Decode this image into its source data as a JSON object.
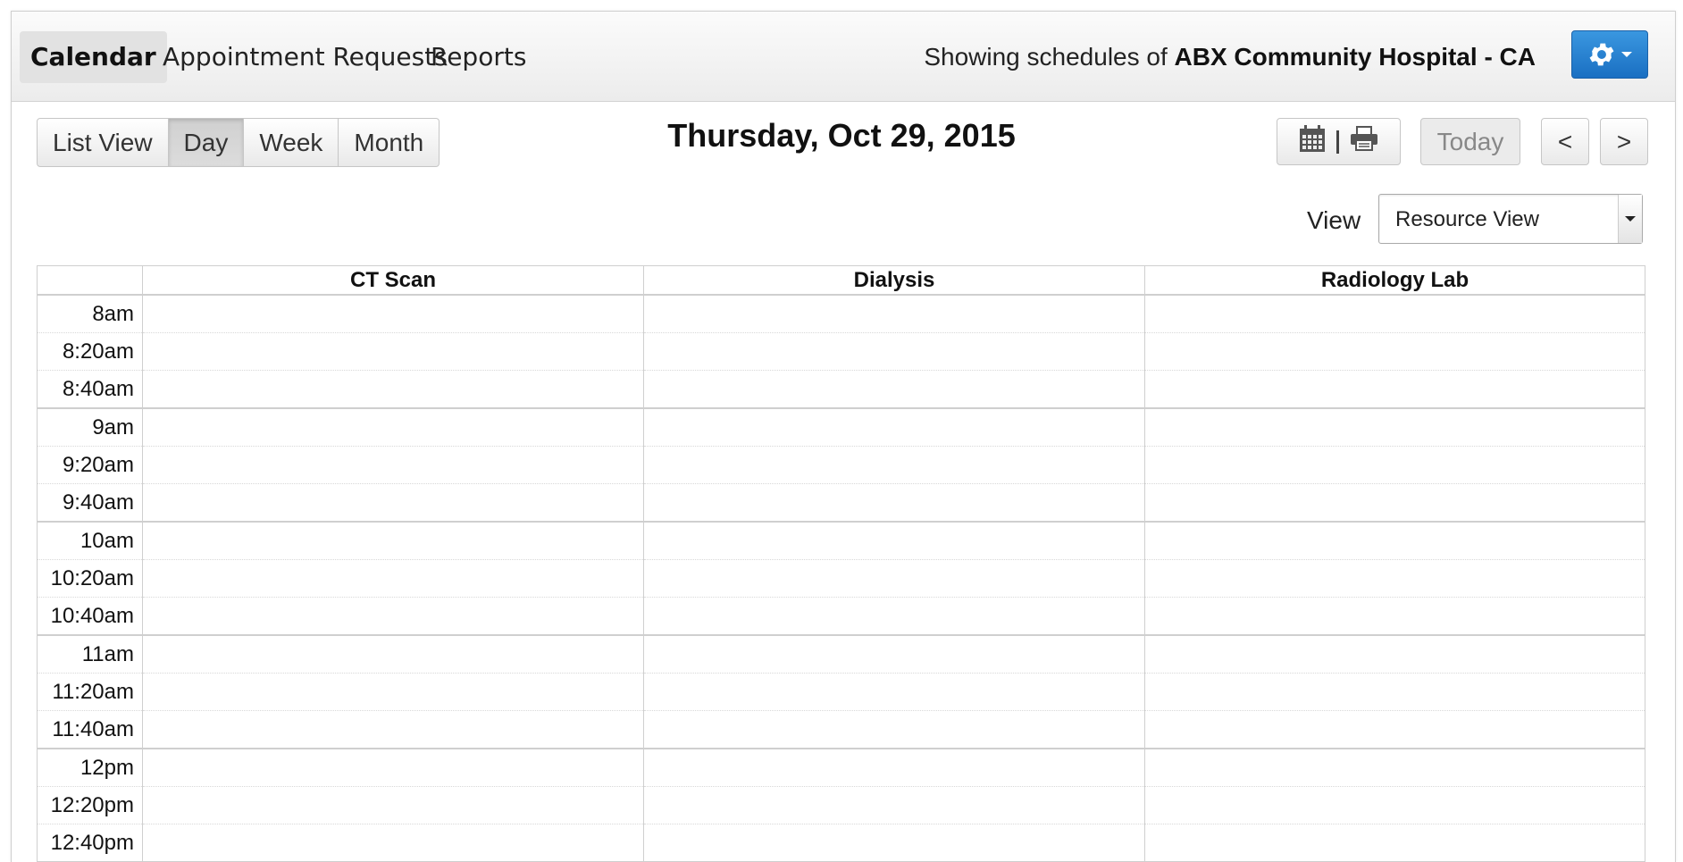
{
  "nav": {
    "tabs": [
      "Calendar",
      "Appointment Requests",
      "Reports"
    ],
    "active_tab": "Calendar",
    "showing_prefix": "Showing schedules of",
    "hospital": "ABX Community Hospital - CA"
  },
  "view_buttons": [
    "List View",
    "Day",
    "Week",
    "Month"
  ],
  "active_view": "Day",
  "date_title": "Thursday, Oct 29, 2015",
  "toolbar": {
    "today_label": "Today",
    "prev_label": "<",
    "next_label": ">"
  },
  "view_selector": {
    "label": "View",
    "value": "Resource View"
  },
  "resources": [
    "CT Scan",
    "Dialysis",
    "Radiology Lab"
  ],
  "time_slots": [
    "8am",
    "8:20am",
    "8:40am",
    "9am",
    "9:20am",
    "9:40am",
    "10am",
    "10:20am",
    "10:40am",
    "11am",
    "11:20am",
    "11:40am",
    "12pm",
    "12:20pm",
    "12:40pm",
    ""
  ],
  "colors": {
    "accent": "#2a82d2",
    "border": "#cfcfcf"
  }
}
